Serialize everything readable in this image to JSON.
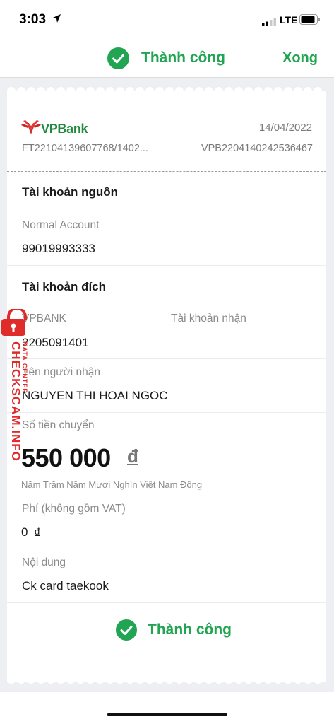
{
  "status_bar": {
    "time": "3:03",
    "network": "LTE"
  },
  "header": {
    "title": "Thành công",
    "done_label": "Xong"
  },
  "receipt": {
    "bank_name": "VPBank",
    "date": "14/04/2022",
    "ref_left": "FT22104139607768/1402...",
    "ref_right": "VPB2204140242536467",
    "source": {
      "section_title": "Tài khoản nguồn",
      "account_type": "Normal Account",
      "account_number": "99019993333"
    },
    "destination": {
      "section_title": "Tài khoản đích",
      "bank": "VPBANK",
      "bank_label": "Tài khoản nhận",
      "account_number": "2205091401",
      "recipient_label": "Tên người nhận",
      "recipient_name": "NGUYEN THI HOAI NGOC"
    },
    "amount": {
      "label": "Số tiền chuyển",
      "value": "550 000",
      "currency": "đ",
      "in_words": "Năm Trăm Năm Mươi Nghìn Việt Nam Đồng"
    },
    "fee": {
      "label": "Phí (không gồm VAT)",
      "value": "0",
      "currency": "đ"
    },
    "content": {
      "label": "Nội dung",
      "value": "Ck card taekook"
    },
    "status": "Thành công"
  },
  "watermark": {
    "text": "CHECKSCAM.INFO",
    "sub": "DATA CENTER"
  },
  "colors": {
    "success": "#22a552",
    "watermark": "#e02b2b",
    "background": "#eeeff3"
  }
}
